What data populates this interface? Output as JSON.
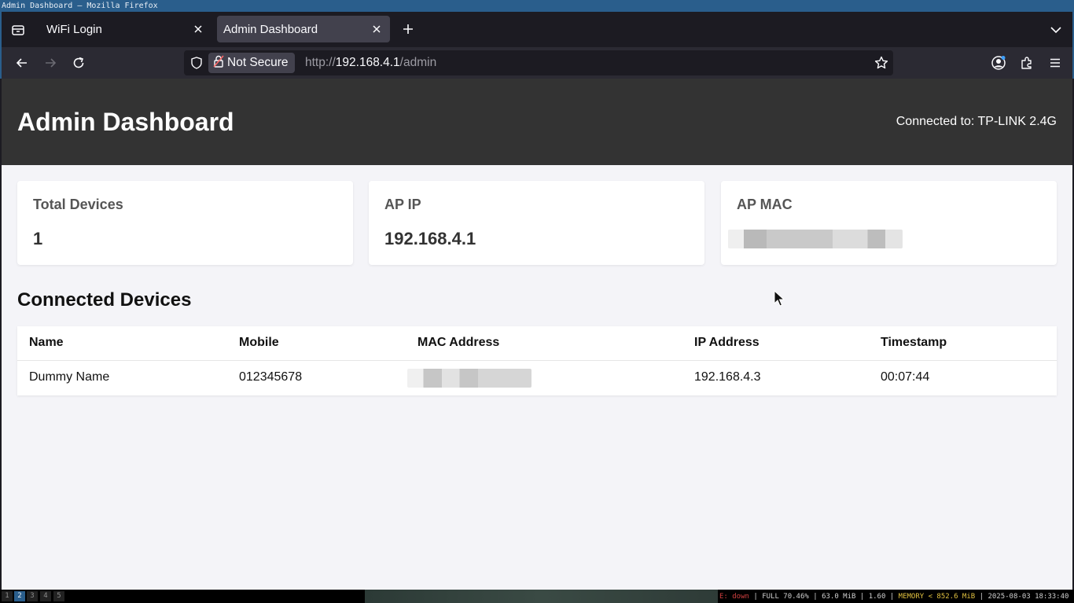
{
  "window": {
    "title": "Admin Dashboard — Mozilla Firefox"
  },
  "tabs": [
    {
      "label": "WiFi Login",
      "active": false
    },
    {
      "label": "Admin Dashboard",
      "active": true
    }
  ],
  "urlbar": {
    "security_label": "Not Secure",
    "url_prefix": "http://",
    "url_host": "192.168.4.1",
    "url_path": "/admin"
  },
  "header": {
    "title": "Admin Dashboard",
    "connection": "Connected to: TP-LINK 2.4G"
  },
  "stats": [
    {
      "label": "Total Devices",
      "value": "1"
    },
    {
      "label": "AP IP",
      "value": "192.168.4.1"
    },
    {
      "label": "AP MAC",
      "value": ""
    }
  ],
  "devices_section": {
    "title": "Connected Devices"
  },
  "table": {
    "columns": [
      "Name",
      "Mobile",
      "MAC Address",
      "IP Address",
      "Timestamp"
    ],
    "rows": [
      {
        "name": "Dummy Name",
        "mobile": "012345678",
        "mac": "",
        "ip": "192.168.4.3",
        "timestamp": "00:07:44"
      }
    ]
  },
  "statusbar": {
    "workspaces": [
      "1",
      "2",
      "3",
      "4",
      "5"
    ],
    "active_workspace": "2",
    "network": "E: down",
    "disk": "FULL 70.46%",
    "swap": "63.0 MiB",
    "load": "1.60",
    "memory": "MEMORY < 852.6 MiB",
    "datetime": "2025-08-03 18:33:40"
  },
  "colors": {
    "header_bg": "#333333",
    "page_bg": "#f4f4f8",
    "accent_border": "#2a5e8c",
    "memory_text": "#e0c040",
    "network_down": "#d04040"
  },
  "icons": [
    "tab-list-icon",
    "close-icon",
    "plus-icon",
    "chevron-down-icon",
    "back-arrow-icon",
    "forward-arrow-icon",
    "reload-icon",
    "shield-icon",
    "lock-warning-icon",
    "star-icon",
    "account-icon",
    "extensions-icon",
    "menu-icon",
    "mouse-cursor-icon"
  ]
}
